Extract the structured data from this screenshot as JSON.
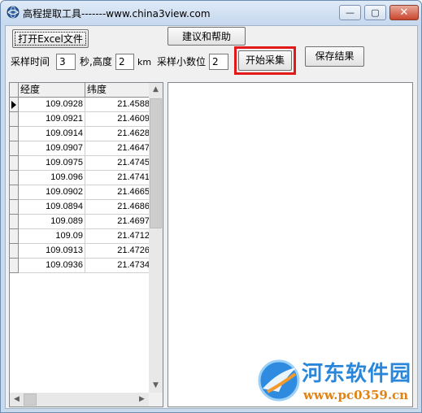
{
  "window": {
    "title": "高程提取工具-------www.china3view.com",
    "controls": {
      "minimize": "—",
      "maximize": "▢",
      "close": "✕"
    }
  },
  "toolbar": {
    "open_excel_label": "打开Excel文件",
    "help_label": "建议和帮助",
    "start_label": "开始采集",
    "save_label": "保存结果"
  },
  "params": {
    "interval_label": "采样时间",
    "interval_value": "3",
    "seconds_height_label": "秒,高度",
    "height_value": "2",
    "km_label": "km",
    "decimals_label": "采样小数位",
    "decimals_value": "2"
  },
  "grid": {
    "columns": [
      "经度",
      "纬度"
    ],
    "rows": [
      [
        "109.0928",
        "21.4588"
      ],
      [
        "109.0921",
        "21.4609"
      ],
      [
        "109.0914",
        "21.4628"
      ],
      [
        "109.0907",
        "21.4647"
      ],
      [
        "109.0975",
        "21.4745"
      ],
      [
        "109.096",
        "21.4741"
      ],
      [
        "109.0902",
        "21.4665"
      ],
      [
        "109.0894",
        "21.4686"
      ],
      [
        "109.089",
        "21.4697"
      ],
      [
        "109.09",
        "21.4712"
      ],
      [
        "109.0913",
        "21.4726"
      ],
      [
        "109.0936",
        "21.4734"
      ]
    ],
    "scroll": {
      "up": "▲",
      "down": "▼",
      "left": "◀",
      "right": "▶"
    }
  },
  "watermark": {
    "title": "河东软件园",
    "url": "www.pc0359.cn"
  },
  "colors": {
    "highlight": "#e31818",
    "watermark_blue": "#2a86d9",
    "watermark_orange": "#e08214"
  }
}
